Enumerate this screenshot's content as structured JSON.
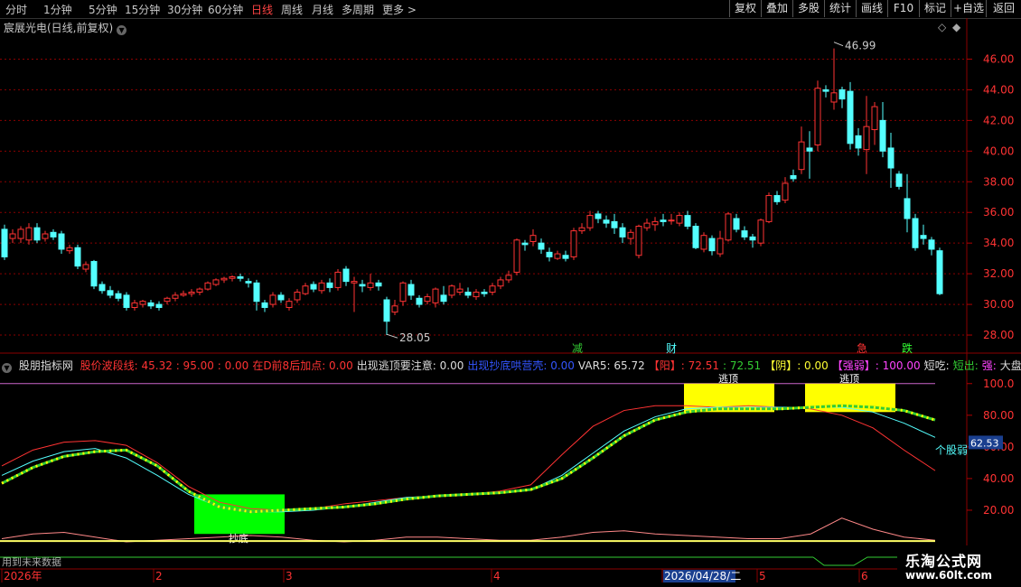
{
  "toolbar": {
    "periods": [
      "分时",
      "1分钟",
      "5分钟",
      "15分钟",
      "30分钟",
      "60分钟",
      "日线",
      "周线",
      "月线",
      "多周期",
      "更多 >"
    ],
    "active_period": "日线",
    "right_buttons": [
      "复权",
      "叠加",
      "多股",
      "统计",
      "画线",
      "F10",
      "+自选",
      "返回"
    ],
    "back_label": "标记"
  },
  "stock": {
    "title": "宸展光电(日线,前复权)",
    "menu_icon": "chevron-down-icon"
  },
  "price_axis": {
    "ticks": [
      "46.00",
      "44.00",
      "42.00",
      "40.00",
      "38.00",
      "36.00",
      "34.00",
      "32.00",
      "30.00",
      "28.00"
    ]
  },
  "annotations": {
    "high": "46.99",
    "low": "28.05",
    "markers": [
      "减",
      "财",
      "急",
      "跌"
    ]
  },
  "indicator": {
    "name": "股朋指标网",
    "items": [
      {
        "label": "股价波段线: 45.32 : 95.00 : 0.00",
        "color": "#ff3333"
      },
      {
        "label": "在D前8后加点: 0.00",
        "color": "#ff3333"
      },
      {
        "label": "出现逃顶要注意: 0.00",
        "color": "#dddddd"
      },
      {
        "label": "出现抄底哄营壳: 0.00",
        "color": "#3355ff"
      },
      {
        "label": "VAR5: 65.72",
        "color": "#dddddd"
      },
      {
        "label": "【阳】: 72.51",
        "color": "#ff3333"
      },
      {
        "label": ": 72.51",
        "color": "#33cc33"
      },
      {
        "label": "【阴】: 0.00",
        "color": "#ffff33"
      },
      {
        "label": "【强弱】: 100.00",
        "color": "#ff44ff"
      },
      {
        "label": "短吃:",
        "color": "#dddddd"
      },
      {
        "label": "短出:",
        "color": "#33cc33"
      },
      {
        "label": "强:",
        "color": "#ff44ff"
      },
      {
        "label": "大盘",
        "color": "#dddddd"
      }
    ],
    "axis_ticks": [
      "100.0",
      "80.00",
      "60.00",
      "40.00",
      "20.00"
    ],
    "current_value": "62.53",
    "series_label": "个股弱",
    "box_labels": [
      "逃顶",
      "逃顶",
      "抄底"
    ]
  },
  "time_axis": {
    "labels": [
      "2026年",
      "2",
      "3",
      "4",
      "2026/04/28/二",
      "5",
      "6"
    ],
    "future_note": "用到未来数据"
  },
  "watermark": {
    "line1": "乐淘公式网",
    "line2": "www.60lt.com"
  },
  "colors": {
    "up": "#ff3333",
    "down": "#54ffff",
    "bg": "#000000",
    "grid": "#8b0000"
  },
  "chart_data": {
    "type": "candlestick",
    "candles": [
      [
        34.9,
        33.1,
        35.2,
        32.9
      ],
      [
        34.3,
        34.6,
        34.9,
        34.0
      ],
      [
        34.3,
        34.9,
        35.1,
        34.0
      ],
      [
        34.2,
        35.0,
        35.3,
        33.9
      ],
      [
        35.0,
        34.2,
        35.3,
        34.0
      ],
      [
        34.3,
        34.6,
        34.8,
        34.1
      ],
      [
        34.7,
        34.4,
        34.9,
        34.2
      ],
      [
        34.6,
        33.6,
        34.8,
        33.3
      ],
      [
        33.5,
        33.7,
        33.9,
        33.3
      ],
      [
        33.7,
        32.5,
        33.9,
        32.3
      ],
      [
        32.3,
        32.6,
        32.8,
        32.1
      ],
      [
        32.8,
        31.2,
        32.9,
        31.0
      ],
      [
        31.3,
        30.9,
        31.5,
        30.7
      ],
      [
        30.9,
        30.6,
        31.2,
        30.4
      ],
      [
        30.7,
        30.4,
        30.9,
        30.2
      ],
      [
        30.6,
        29.8,
        30.8,
        29.6
      ],
      [
        29.8,
        30.1,
        30.3,
        29.6
      ],
      [
        30.0,
        30.2,
        30.3,
        29.8
      ],
      [
        30.1,
        29.9,
        30.3,
        29.7
      ],
      [
        30.0,
        29.8,
        30.2,
        29.6
      ],
      [
        30.2,
        30.4,
        30.5,
        30.0
      ],
      [
        30.4,
        30.6,
        30.8,
        30.2
      ],
      [
        30.6,
        30.7,
        30.9,
        30.5
      ],
      [
        30.7,
        30.8,
        31.0,
        30.5
      ],
      [
        30.8,
        31.0,
        31.1,
        30.6
      ],
      [
        31.0,
        31.4,
        31.5,
        30.9
      ],
      [
        31.3,
        31.6,
        31.7,
        31.2
      ],
      [
        31.6,
        31.7,
        31.8,
        31.4
      ],
      [
        31.7,
        31.8,
        31.9,
        31.5
      ],
      [
        31.8,
        31.7,
        32.0,
        31.5
      ],
      [
        31.5,
        31.4,
        31.7,
        31.1
      ],
      [
        31.4,
        30.2,
        31.6,
        29.6
      ],
      [
        30.1,
        29.8,
        30.3,
        29.5
      ],
      [
        30.0,
        30.6,
        30.8,
        29.8
      ],
      [
        30.6,
        30.3,
        30.8,
        30.1
      ],
      [
        29.8,
        30.2,
        30.4,
        29.6
      ],
      [
        30.3,
        30.8,
        31.0,
        30.1
      ],
      [
        30.7,
        31.2,
        31.4,
        30.6
      ],
      [
        31.3,
        31.0,
        31.5,
        30.8
      ],
      [
        30.9,
        31.4,
        31.6,
        30.7
      ],
      [
        31.4,
        31.1,
        31.7,
        30.8
      ],
      [
        31.1,
        32.1,
        32.3,
        30.9
      ],
      [
        32.3,
        31.5,
        32.5,
        31.2
      ],
      [
        31.4,
        31.5,
        31.8,
        29.5
      ],
      [
        31.3,
        31.2,
        31.6,
        30.8
      ],
      [
        31.1,
        31.4,
        32.0,
        30.9
      ],
      [
        31.4,
        31.2,
        31.6,
        30.9
      ],
      [
        30.3,
        28.9,
        30.5,
        28.0
      ],
      [
        29.5,
        29.9,
        30.3,
        29.3
      ],
      [
        30.2,
        31.4,
        31.5,
        29.9
      ],
      [
        31.3,
        30.6,
        31.6,
        30.3
      ],
      [
        30.4,
        30.0,
        30.6,
        29.8
      ],
      [
        30.2,
        30.5,
        30.7,
        30.0
      ],
      [
        30.1,
        31.0,
        31.1,
        29.8
      ],
      [
        30.6,
        30.2,
        31.2,
        30.0
      ],
      [
        30.6,
        31.2,
        31.3,
        30.4
      ],
      [
        30.8,
        31.0,
        31.4,
        30.6
      ],
      [
        30.8,
        30.6,
        31.1,
        30.4
      ],
      [
        30.5,
        30.8,
        31.0,
        30.3
      ],
      [
        30.8,
        30.7,
        31.0,
        30.5
      ],
      [
        30.8,
        31.2,
        31.4,
        30.6
      ],
      [
        31.2,
        31.6,
        31.8,
        31.0
      ],
      [
        31.6,
        31.9,
        32.2,
        31.4
      ],
      [
        32.1,
        34.2,
        34.3,
        31.9
      ],
      [
        34.0,
        33.9,
        34.2,
        33.5
      ],
      [
        34.1,
        34.5,
        34.9,
        33.8
      ],
      [
        34.0,
        33.6,
        34.3,
        33.3
      ],
      [
        33.4,
        33.1,
        33.7,
        32.8
      ],
      [
        33.0,
        33.3,
        33.5,
        32.9
      ],
      [
        33.2,
        33.0,
        33.5,
        32.8
      ],
      [
        33.1,
        34.8,
        35.0,
        32.9
      ],
      [
        34.8,
        35.0,
        35.3,
        34.6
      ],
      [
        35.0,
        35.8,
        36.1,
        34.8
      ],
      [
        35.9,
        35.6,
        36.1,
        35.3
      ],
      [
        35.5,
        35.3,
        35.8,
        35.0
      ],
      [
        35.4,
        35.0,
        35.9,
        34.6
      ],
      [
        35.0,
        34.4,
        35.3,
        34.0
      ],
      [
        34.3,
        34.7,
        34.9,
        33.9
      ],
      [
        33.2,
        35.1,
        35.2,
        33.0
      ],
      [
        35.0,
        35.3,
        35.6,
        34.8
      ],
      [
        35.2,
        35.4,
        35.7,
        34.8
      ],
      [
        35.5,
        35.4,
        35.9,
        35.1
      ],
      [
        35.5,
        35.5,
        35.9,
        35.2
      ],
      [
        35.3,
        35.8,
        36.0,
        35.1
      ],
      [
        35.8,
        35.1,
        36.1,
        34.9
      ],
      [
        35.1,
        33.7,
        35.3,
        33.6
      ],
      [
        33.6,
        34.5,
        34.7,
        33.4
      ],
      [
        34.3,
        33.5,
        34.5,
        33.2
      ],
      [
        33.3,
        34.3,
        34.8,
        33.1
      ],
      [
        34.2,
        35.9,
        36.0,
        34.1
      ],
      [
        35.6,
        34.9,
        35.9,
        34.7
      ],
      [
        34.8,
        34.4,
        35.1,
        34.2
      ],
      [
        34.4,
        34.2,
        34.6,
        33.7
      ],
      [
        34.0,
        35.5,
        35.6,
        33.8
      ],
      [
        35.4,
        37.1,
        37.3,
        35.3
      ],
      [
        37.1,
        36.7,
        37.4,
        36.5
      ],
      [
        36.8,
        37.9,
        38.3,
        36.6
      ],
      [
        38.4,
        38.2,
        38.8,
        38.0
      ],
      [
        38.8,
        40.6,
        41.6,
        38.5
      ],
      [
        40.2,
        40.0,
        41.3,
        38.2
      ],
      [
        40.4,
        44.1,
        44.6,
        40.0
      ],
      [
        44.0,
        43.9,
        44.3,
        43.5
      ],
      [
        43.2,
        43.8,
        46.7,
        42.7
      ],
      [
        44.0,
        43.4,
        44.2,
        42.8
      ],
      [
        43.9,
        40.5,
        44.5,
        40.1
      ],
      [
        41.0,
        40.2,
        41.5,
        39.7
      ],
      [
        40.1,
        41.6,
        43.6,
        38.5
      ],
      [
        41.4,
        42.9,
        43.2,
        40.4
      ],
      [
        42.0,
        40.0,
        43.2,
        39.6
      ],
      [
        40.2,
        38.9,
        41.2,
        37.6
      ],
      [
        38.5,
        37.7,
        38.7,
        37.5
      ],
      [
        36.9,
        35.6,
        38.5,
        34.7
      ],
      [
        35.6,
        33.7,
        35.9,
        33.5
      ],
      [
        34.5,
        34.3,
        35.2,
        33.9
      ],
      [
        34.2,
        33.6,
        34.4,
        33.2
      ],
      [
        33.5,
        30.7,
        33.7,
        30.6
      ]
    ],
    "ylim": [
      27,
      47.5
    ],
    "indicator_ylim": [
      0,
      105
    ],
    "indicator_series": {
      "red_line": [
        48,
        58,
        63,
        64,
        61,
        50,
        35,
        25,
        21,
        20,
        21,
        24,
        26,
        28,
        29,
        30,
        32,
        36,
        55,
        73,
        83,
        86,
        86,
        85,
        86,
        85,
        84,
        80,
        72,
        58,
        45
      ],
      "cyan_line": [
        42,
        51,
        57,
        59,
        53,
        42,
        30,
        22,
        19,
        19,
        20,
        22,
        25,
        28,
        29,
        30,
        31,
        33,
        42,
        56,
        70,
        79,
        84,
        85,
        85,
        85,
        85,
        85,
        82,
        75,
        66
      ],
      "yellow_dotted": [
        37,
        47,
        54,
        57,
        58,
        48,
        32,
        22,
        19,
        20,
        21,
        22,
        24,
        27,
        29,
        30,
        31,
        33,
        40,
        53,
        67,
        77,
        82,
        84,
        84,
        84,
        85,
        86,
        85,
        83,
        77
      ],
      "small_red": [
        2,
        5,
        6,
        3,
        0,
        1,
        2,
        3,
        4,
        3,
        1,
        0,
        1,
        3,
        3,
        2,
        1,
        1,
        3,
        6,
        7,
        5,
        4,
        3,
        2,
        2,
        5,
        15,
        8,
        3,
        1
      ]
    }
  }
}
